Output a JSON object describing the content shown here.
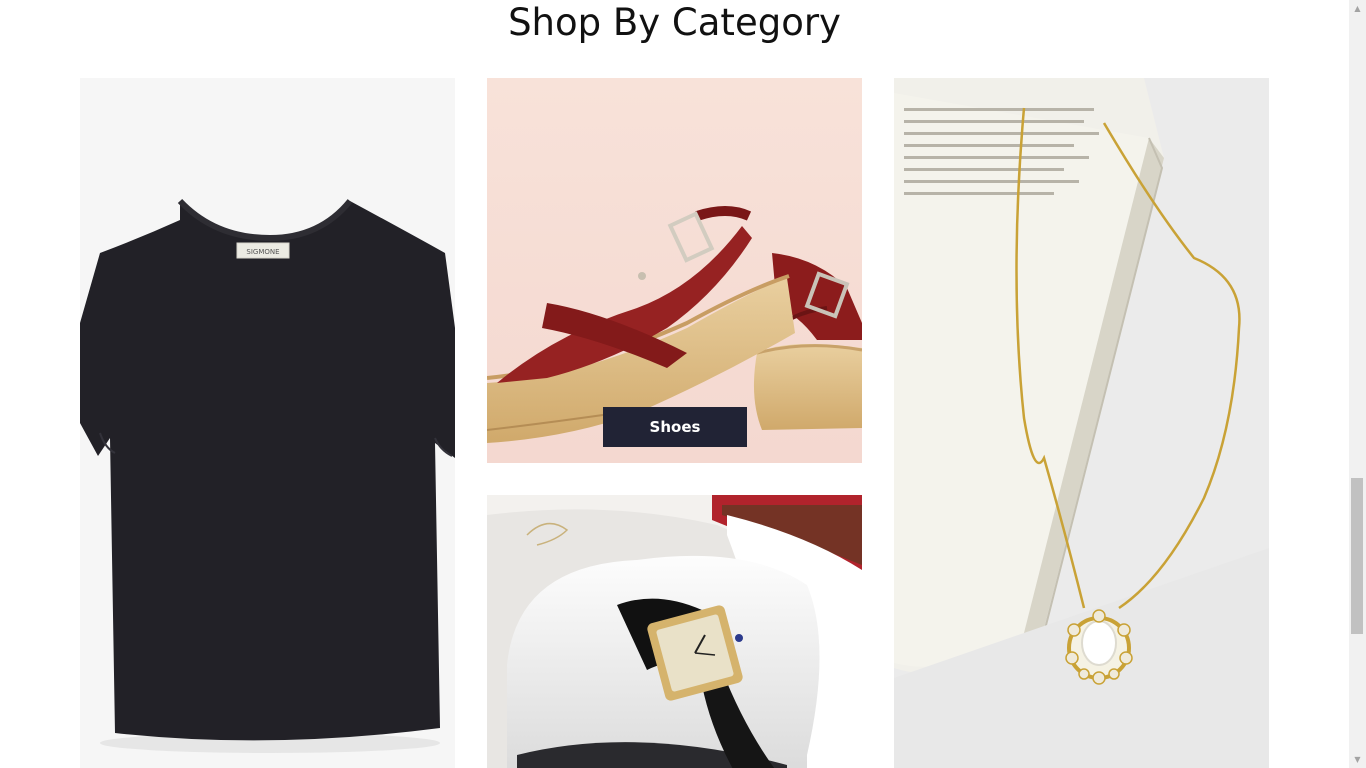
{
  "section": {
    "title": "Shop By Category"
  },
  "categories": [
    {
      "id": "tshirts",
      "image": "black-tshirt-image",
      "label_tag": "SIGMONE"
    },
    {
      "id": "shoes",
      "image": "red-platform-sandals-image",
      "button_label": "Shoes"
    },
    {
      "id": "watches",
      "image": "wristwatch-in-box-image"
    },
    {
      "id": "jewelry",
      "image": "gold-necklace-image"
    }
  ],
  "colors": {
    "button_bg": "#212335",
    "button_text": "#ffffff",
    "title_text": "#111111"
  },
  "scrollbar": {
    "up_icon": "▲",
    "down_icon": "▼"
  }
}
